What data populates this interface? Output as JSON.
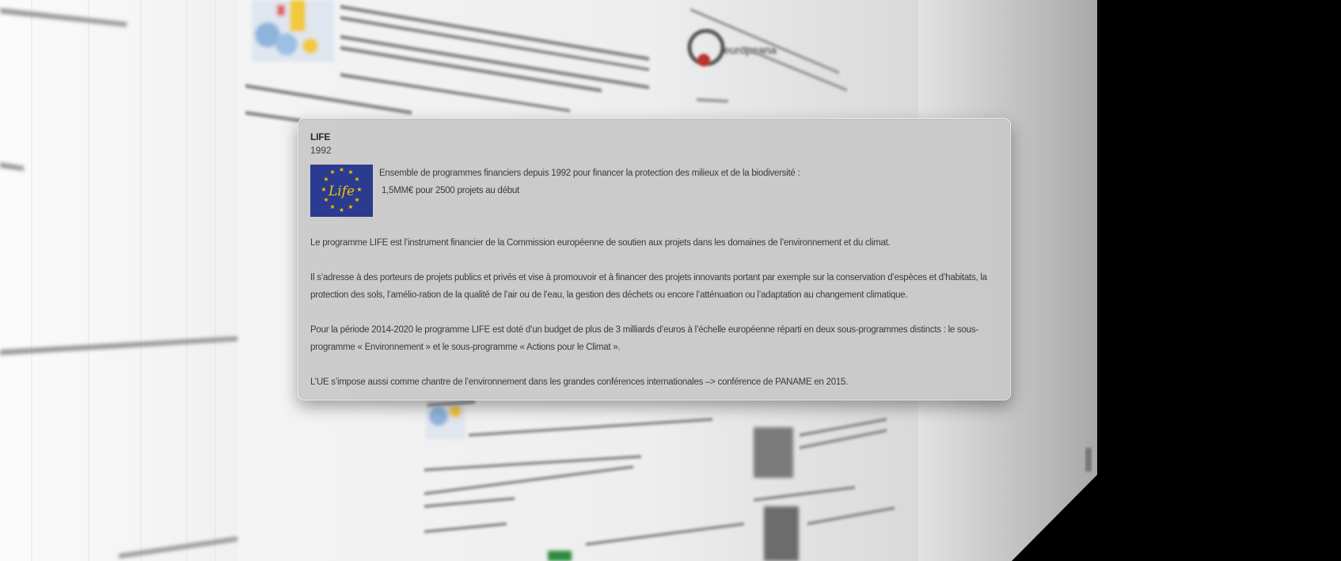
{
  "card": {
    "title": "LIFE",
    "year": "1992",
    "logo_text": "Life",
    "intro_line1": "Ensemble de programmes financiers depuis 1992 pour financer la protection des milieux et de la biodiversité :",
    "intro_line2": "1,5MM€ pour 2500 projets au début",
    "paragraphs": [
      "Le programme LIFE est l’instrument financier de la Commission européenne de soutien aux projets dans les domaines de l’environnement et du climat.",
      "Il s’adresse à des porteurs de projets publics et privés et vise à promouvoir et à financer des projets innovants portant par exemple sur la conservation d’espèces et d’habitats, la protection des sols, l’amélio-ration de la qualité de l’air ou de l’eau, la gestion des déchets ou encore l’atténuation ou l’adaptation au changement climatique.",
      "Pour la période 2014-2020 le programme LIFE est doté d’un budget de plus de 3 milliards d’euros à l’échelle européenne réparti en deux sous-programmes distincts : le sous-programme « Environnement » et le sous-programme « Actions pour le Climat ».",
      "L’UE s’impose aussi comme chantre de l’environnement dans les grandes conférences internationales –> conférence de PANAME en 2015."
    ]
  },
  "background": {
    "logo_name": "europeana"
  },
  "colors": {
    "card_bg": "#c8c8c8",
    "eu_blue": "#2b3b8f",
    "eu_star": "#f2c200",
    "wall_light": "#f1f1f1",
    "wall_shade": "#b9b9b9",
    "outside": "#000000"
  }
}
